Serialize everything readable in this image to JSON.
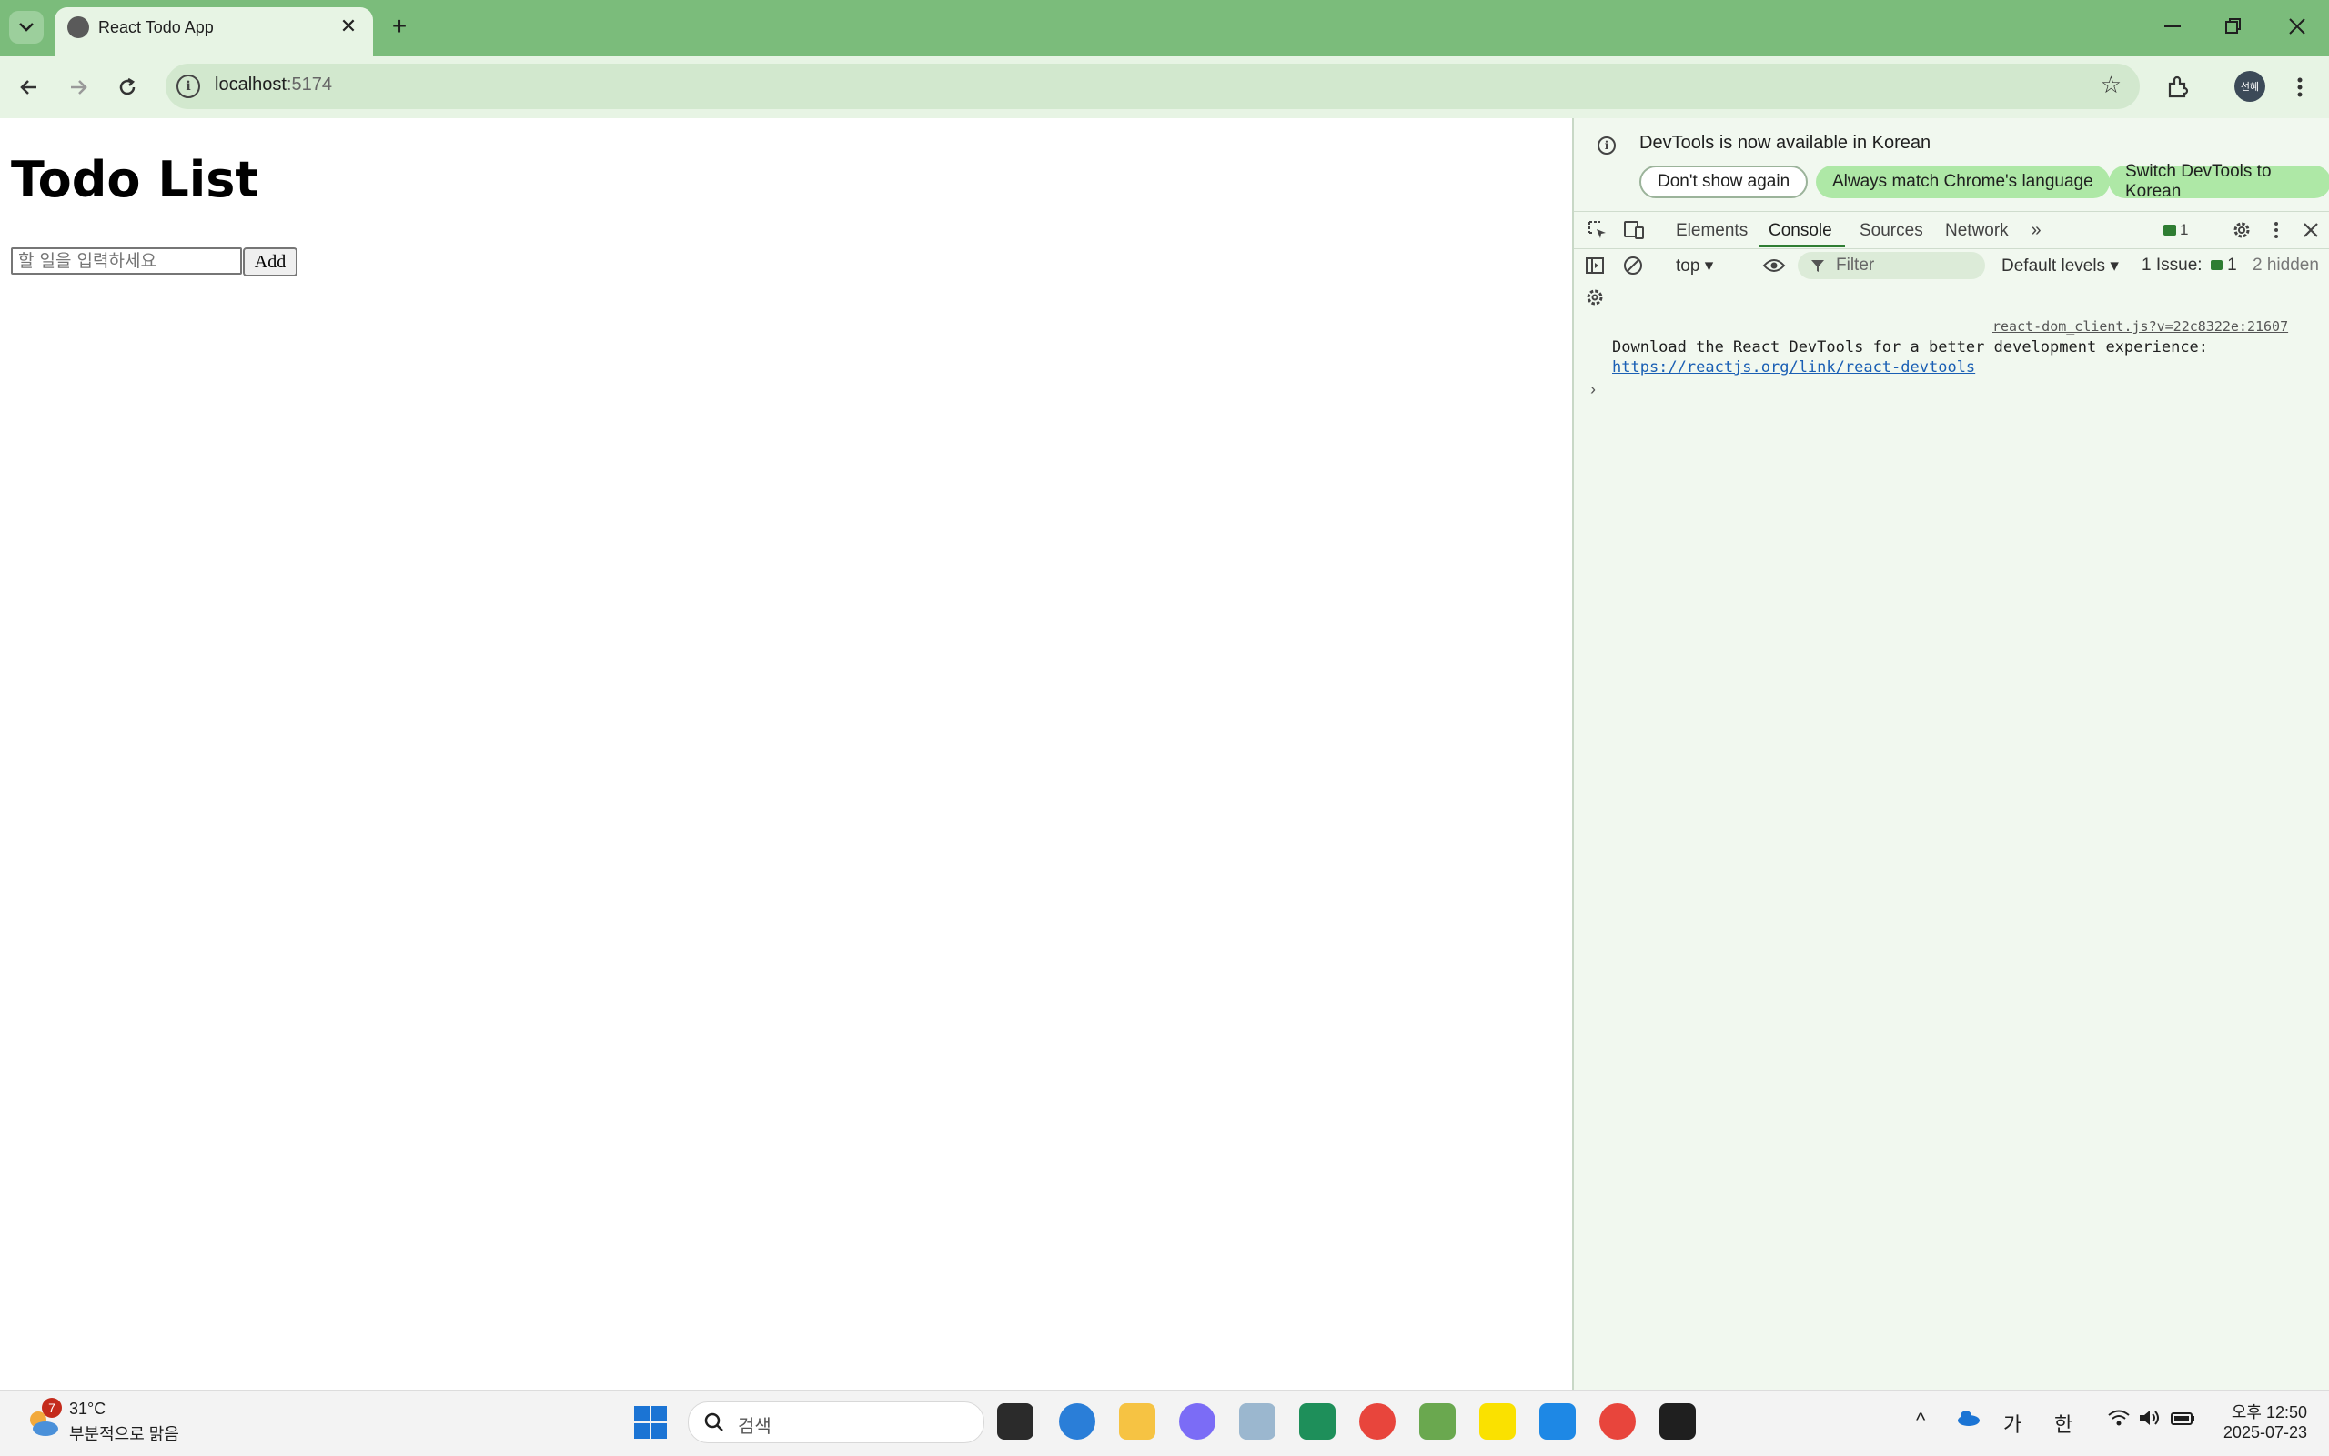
{
  "browser": {
    "tab_title": "React Todo App",
    "url_host": "localhost",
    "url_port": ":5174",
    "profile_initials": "선혜"
  },
  "page": {
    "heading": "Todo List",
    "input_placeholder": "할 일을 입력하세요",
    "input_value": "",
    "add_label": "Add"
  },
  "devtools": {
    "language_message": "DevTools is now available in Korean",
    "dont_show_again": "Don't show again",
    "always_match": "Always match Chrome's language",
    "switch_korean": "Switch DevTools to Korean",
    "tabs": [
      "Elements",
      "Console",
      "Sources",
      "Network"
    ],
    "message_count": "1",
    "context": "top",
    "filter_placeholder": "Filter",
    "levels": "Default levels",
    "issues_label": "1 Issue:",
    "issues_count": "1",
    "hidden": "2 hidden",
    "log_source": "react-dom_client.js?v=22c8322e:21607",
    "log_message": "Download the React DevTools for a better development experience:",
    "log_link": "https://reactjs.org/link/react-devtools"
  },
  "taskbar": {
    "weather_badge": "7",
    "temperature": "31°C",
    "weather_desc": "부분적으로 맑음",
    "search_placeholder": "검색",
    "ime_lang": "가",
    "ime_mode": "한",
    "time": "오후 12:50",
    "date": "2025-07-23"
  },
  "icons": [
    "tab-search-icon",
    "favicon-icon",
    "close-icon",
    "plus-icon",
    "minimize-icon",
    "restore-icon",
    "back-icon",
    "forward-icon",
    "reload-icon",
    "info-icon",
    "star-icon",
    "extensions-icon",
    "more-vert-icon",
    "inspect-icon",
    "device-icon",
    "chevron-double-icon",
    "message-icon",
    "gear-icon",
    "sidebar-icon",
    "clear-icon",
    "eye-icon",
    "filter-icon",
    "windows-start-icon",
    "search-icon"
  ],
  "colors": {
    "chrome_green": "#7bbc7b",
    "tab_bg": "#e7f4e4",
    "devtools_bg": "#f1f8ef",
    "pill_filled": "#aee8a6",
    "active_tab_underline": "#2e7d32"
  }
}
